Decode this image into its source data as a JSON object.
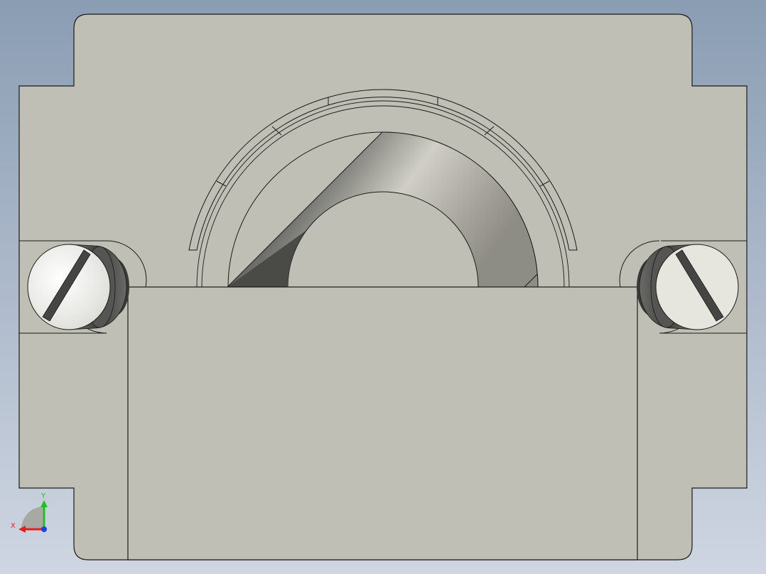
{
  "viewport": {
    "background_top": "#8a9db3",
    "background_bottom": "#cfd6e2",
    "part_fill": "#c0bfb6",
    "edge_color": "#1a1a1a",
    "screw_head_fill": "#f2f2ee",
    "screw_shadow": "#4a4a48",
    "bearing_dark": "#3c3c3a",
    "bearing_light": "#d0cfc6"
  },
  "triad": {
    "x_label": "X",
    "y_label": "Y",
    "x_color": "#e02020",
    "y_color": "#20c020",
    "z_color": "#2040e0"
  }
}
